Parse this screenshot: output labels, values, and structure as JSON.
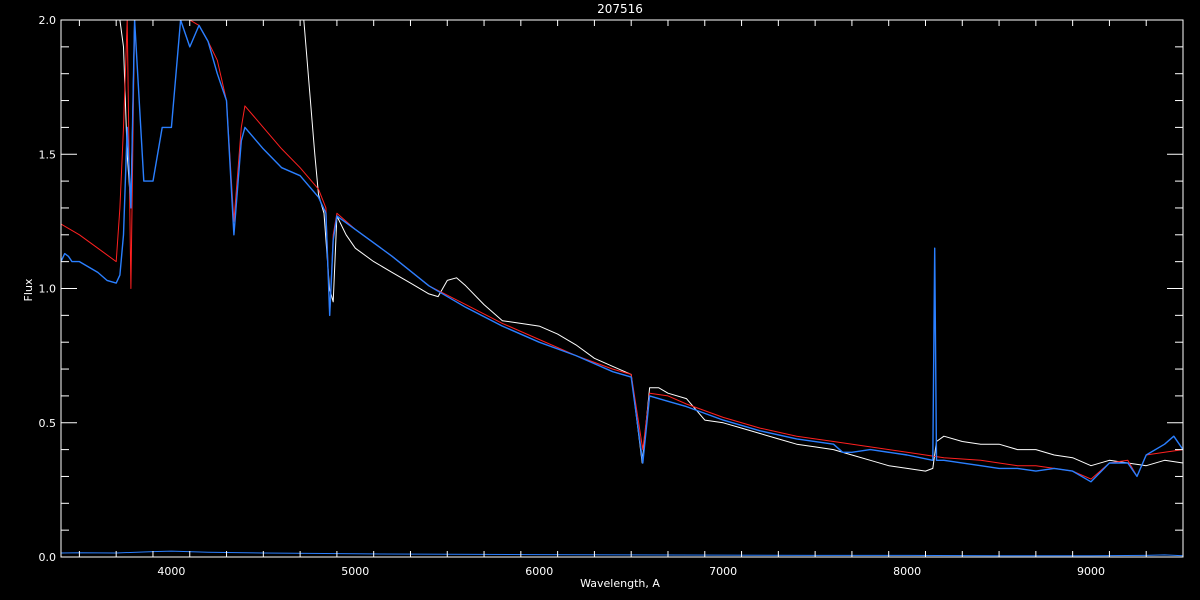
{
  "chart_data": {
    "type": "line",
    "title": "207516",
    "xlabel": "Wavelength, A",
    "ylabel": "Flux",
    "xlim": [
      3400,
      9500
    ],
    "ylim": [
      0.0,
      2.0
    ],
    "x_ticks": [
      4000,
      5000,
      6000,
      7000,
      8000,
      9000
    ],
    "y_ticks": [
      0.0,
      0.5,
      1.0,
      1.5,
      2.0
    ],
    "x_tick_labels": [
      "4000",
      "5000",
      "6000",
      "7000",
      "8000",
      "9000"
    ],
    "y_tick_labels": [
      "0.0",
      "0.5",
      "1.0",
      "1.5",
      "2.0"
    ],
    "background": "#000000",
    "axis_color": "#ffffff",
    "series": [
      {
        "color": "#ffffff",
        "x": [
          3720,
          3740,
          3760,
          3780,
          3800,
          4000,
          4400,
          4600,
          4680,
          4720,
          4750,
          4780,
          4800,
          4830,
          4860,
          4880,
          4900,
          4950,
          5000,
          5100,
          5200,
          5300,
          5400,
          5450,
          5500,
          5550,
          5600,
          5700,
          5800,
          5900,
          6000,
          6100,
          6200,
          6300,
          6400,
          6500,
          6560,
          6600,
          6650,
          6700,
          6800,
          6850,
          6900,
          7000,
          7100,
          7200,
          7300,
          7400,
          7500,
          7600,
          7700,
          7800,
          7900,
          8000,
          8100,
          8140,
          8160,
          8200,
          8300,
          8400,
          8500,
          8600,
          8700,
          8800,
          8900,
          9000,
          9100,
          9200,
          9300,
          9400,
          9500
        ],
        "y": [
          2.0,
          1.9,
          1.5,
          1.3,
          2.0,
          2.0,
          2.0,
          2.0,
          2.0,
          2.0,
          1.75,
          1.5,
          1.35,
          1.28,
          1.0,
          0.95,
          1.27,
          1.2,
          1.15,
          1.1,
          1.06,
          1.02,
          0.98,
          0.97,
          1.03,
          1.04,
          1.01,
          0.94,
          0.88,
          0.87,
          0.86,
          0.83,
          0.79,
          0.74,
          0.71,
          0.68,
          0.35,
          0.63,
          0.63,
          0.61,
          0.59,
          0.55,
          0.51,
          0.5,
          0.48,
          0.46,
          0.44,
          0.42,
          0.41,
          0.4,
          0.38,
          0.36,
          0.34,
          0.33,
          0.32,
          0.33,
          0.43,
          0.45,
          0.43,
          0.42,
          0.42,
          0.4,
          0.4,
          0.38,
          0.37,
          0.34,
          0.36,
          0.35,
          0.34,
          0.36,
          0.35
        ]
      },
      {
        "color": "#ff2020",
        "x": [
          3400,
          3500,
          3600,
          3700,
          3720,
          3740,
          3760,
          3780,
          3800,
          3900,
          4000,
          4100,
          4150,
          4200,
          4250,
          4300,
          4340,
          4380,
          4400,
          4500,
          4600,
          4700,
          4800,
          4840,
          4861,
          4880,
          4900,
          5000,
          5200,
          5400,
          5600,
          5800,
          6000,
          6200,
          6400,
          6500,
          6563,
          6600,
          6700,
          6800,
          7000,
          7200,
          7400,
          7600,
          7800,
          8000,
          8200,
          8400,
          8500,
          8600,
          8700,
          8800,
          8900,
          9000,
          9100,
          9200,
          9250,
          9300,
          9400,
          9500
        ],
        "y": [
          1.24,
          1.2,
          1.15,
          1.1,
          1.3,
          1.6,
          2.0,
          1.0,
          2.0,
          2.0,
          2.0,
          2.0,
          1.98,
          1.92,
          1.85,
          1.7,
          1.25,
          1.6,
          1.68,
          1.6,
          1.52,
          1.45,
          1.37,
          1.3,
          0.9,
          1.2,
          1.28,
          1.22,
          1.12,
          1.01,
          0.94,
          0.87,
          0.81,
          0.75,
          0.7,
          0.68,
          0.4,
          0.61,
          0.6,
          0.57,
          0.52,
          0.48,
          0.45,
          0.43,
          0.41,
          0.39,
          0.37,
          0.36,
          0.35,
          0.34,
          0.34,
          0.33,
          0.32,
          0.29,
          0.35,
          0.36,
          0.3,
          0.38,
          0.39,
          0.4
        ]
      },
      {
        "color": "#2a7fff",
        "x": [
          3400,
          3420,
          3440,
          3460,
          3500,
          3550,
          3600,
          3650,
          3700,
          3720,
          3740,
          3760,
          3780,
          3800,
          3850,
          3900,
          3950,
          4000,
          4050,
          4100,
          4150,
          4200,
          4250,
          4300,
          4340,
          4380,
          4400,
          4500,
          4600,
          4700,
          4800,
          4840,
          4861,
          4880,
          4900,
          5000,
          5200,
          5400,
          5600,
          5800,
          6000,
          6200,
          6400,
          6500,
          6563,
          6600,
          6700,
          6800,
          7000,
          7200,
          7400,
          7600,
          7650,
          7700,
          7800,
          8000,
          8140,
          8150,
          8160,
          8200,
          8400,
          8500,
          8600,
          8700,
          8800,
          8900,
          9000,
          9100,
          9200,
          9250,
          9300,
          9400,
          9450,
          9500
        ],
        "y": [
          1.1,
          1.13,
          1.12,
          1.1,
          1.1,
          1.08,
          1.06,
          1.03,
          1.02,
          1.05,
          1.2,
          1.6,
          1.3,
          2.0,
          1.4,
          1.4,
          1.6,
          1.6,
          2.0,
          1.9,
          1.98,
          1.92,
          1.8,
          1.7,
          1.2,
          1.55,
          1.6,
          1.52,
          1.45,
          1.42,
          1.34,
          1.28,
          0.9,
          1.18,
          1.27,
          1.22,
          1.12,
          1.01,
          0.93,
          0.86,
          0.8,
          0.75,
          0.69,
          0.67,
          0.35,
          0.6,
          0.58,
          0.56,
          0.51,
          0.47,
          0.44,
          0.42,
          0.39,
          0.39,
          0.4,
          0.38,
          0.36,
          1.15,
          0.36,
          0.36,
          0.34,
          0.33,
          0.33,
          0.32,
          0.33,
          0.32,
          0.28,
          0.35,
          0.35,
          0.3,
          0.38,
          0.42,
          0.45,
          0.4
        ]
      },
      {
        "color": "#2a7fff",
        "x": [
          3400,
          3500,
          3700,
          3900,
          4000,
          4200,
          4500,
          5000,
          5500,
          6000,
          6500,
          7000,
          7500,
          8000,
          8500,
          9000,
          9300,
          9400,
          9500
        ],
        "y": [
          0.015,
          0.016,
          0.015,
          0.02,
          0.022,
          0.018,
          0.015,
          0.012,
          0.01,
          0.009,
          0.008,
          0.007,
          0.006,
          0.006,
          0.005,
          0.005,
          0.006,
          0.008,
          0.005
        ]
      }
    ]
  }
}
